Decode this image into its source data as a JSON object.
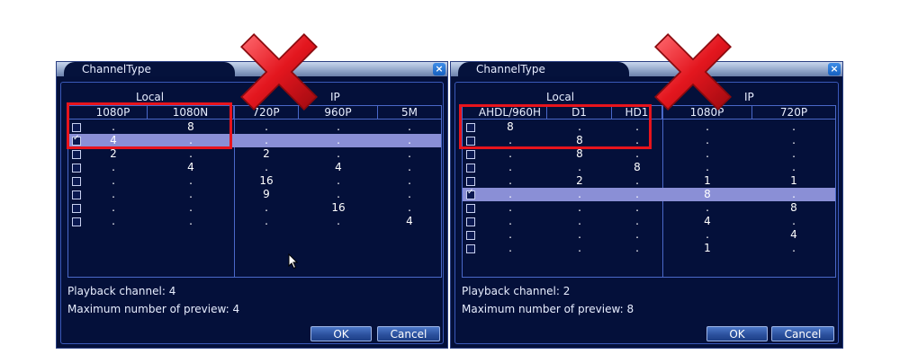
{
  "left": {
    "title": "ChannelType",
    "close": "×",
    "group_local": "Local",
    "group_ip": "IP",
    "headers": [
      "1080P",
      "1080N",
      "720P",
      "960P",
      "5M"
    ],
    "rows": [
      {
        "checked": false,
        "cells": [
          ".",
          "8",
          ".",
          ".",
          "."
        ],
        "selected": false
      },
      {
        "checked": true,
        "cells": [
          "4",
          ".",
          ".",
          ".",
          "."
        ],
        "selected": true
      },
      {
        "checked": false,
        "cells": [
          "2",
          ".",
          "2",
          ".",
          "."
        ],
        "selected": false
      },
      {
        "checked": false,
        "cells": [
          ".",
          "4",
          ".",
          "4",
          "."
        ],
        "selected": false
      },
      {
        "checked": false,
        "cells": [
          ".",
          ".",
          "16",
          ".",
          "."
        ],
        "selected": false
      },
      {
        "checked": false,
        "cells": [
          ".",
          ".",
          "9",
          ".",
          "."
        ],
        "selected": false
      },
      {
        "checked": false,
        "cells": [
          ".",
          ".",
          ".",
          "16",
          "."
        ],
        "selected": false
      },
      {
        "checked": false,
        "cells": [
          ".",
          ".",
          ".",
          ".",
          "4"
        ],
        "selected": false
      }
    ],
    "playback": "Playback channel: 4",
    "max_preview": "Maximum number of preview: 4",
    "ok": "OK",
    "cancel": "Cancel"
  },
  "right": {
    "title": "ChannelType",
    "close": "×",
    "group_local": "Local",
    "group_ip": "IP",
    "headers": [
      "AHDL/960H",
      "D1",
      "HD1",
      "1080P",
      "720P"
    ],
    "rows": [
      {
        "checked": false,
        "cells": [
          "8",
          ".",
          ".",
          ".",
          "."
        ],
        "selected": false
      },
      {
        "checked": false,
        "cells": [
          ".",
          "8",
          ".",
          ".",
          "."
        ],
        "selected": false
      },
      {
        "checked": false,
        "cells": [
          ".",
          "8",
          ".",
          ".",
          "."
        ],
        "selected": false
      },
      {
        "checked": false,
        "cells": [
          ".",
          ".",
          "8",
          ".",
          "."
        ],
        "selected": false
      },
      {
        "checked": false,
        "cells": [
          ".",
          "2",
          ".",
          "1",
          "1"
        ],
        "selected": false
      },
      {
        "checked": true,
        "cells": [
          ".",
          ".",
          ".",
          "8",
          "."
        ],
        "selected": true
      },
      {
        "checked": false,
        "cells": [
          ".",
          ".",
          ".",
          ".",
          "8"
        ],
        "selected": false
      },
      {
        "checked": false,
        "cells": [
          ".",
          ".",
          ".",
          "4",
          "."
        ],
        "selected": false
      },
      {
        "checked": false,
        "cells": [
          ".",
          ".",
          ".",
          ".",
          "4"
        ],
        "selected": false
      },
      {
        "checked": false,
        "cells": [
          ".",
          ".",
          ".",
          "1",
          "."
        ],
        "selected": false
      }
    ],
    "playback": "Playback channel: 2",
    "max_preview": "Maximum number of preview: 8",
    "ok": "OK",
    "cancel": "Cancel"
  }
}
